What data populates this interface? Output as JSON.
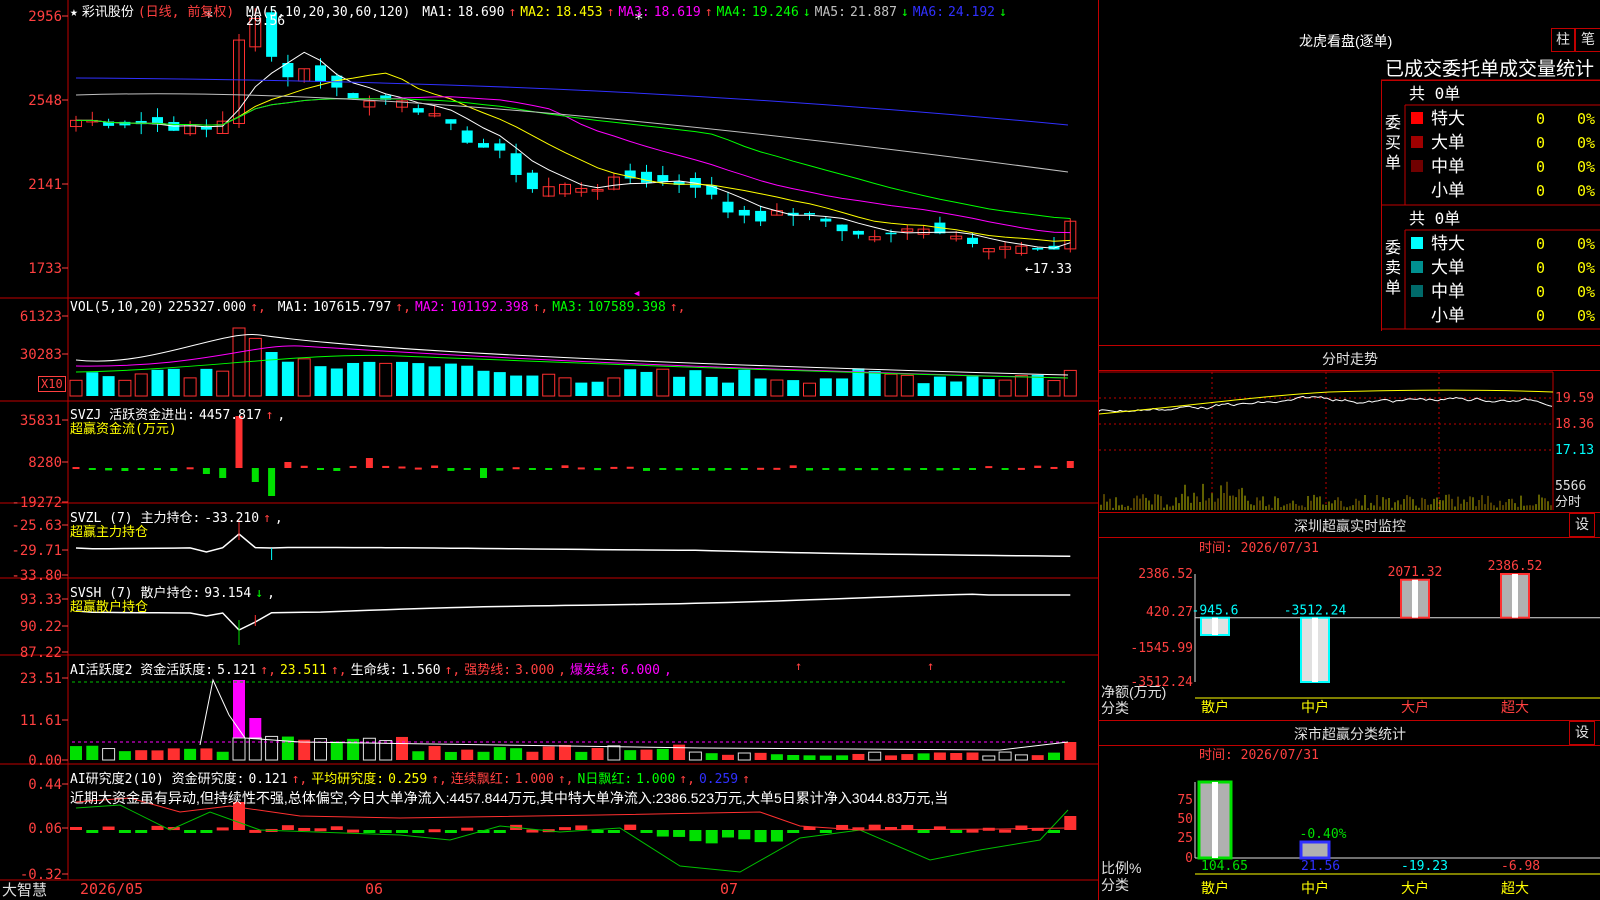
{
  "stock": {
    "name": "彩讯股份",
    "period": "(日线, 前复权)",
    "star": "★"
  },
  "main": {
    "ma_label": "MA(5,10,20,30,60,120)",
    "ma": [
      {
        "label": "MA1:",
        "value": "18.690",
        "dir": "↑",
        "color": "#ffffff"
      },
      {
        "label": "MA2:",
        "value": "18.453",
        "dir": "↑",
        "color": "#ffff00"
      },
      {
        "label": "MA3:",
        "value": "18.619",
        "dir": "↑",
        "color": "#ff00ff"
      },
      {
        "label": "MA4:",
        "value": "19.246",
        "dir": "↓",
        "color": "#00ff00"
      },
      {
        "label": "MA5:",
        "value": "21.887",
        "dir": "↓",
        "color": "#c0c0c0"
      },
      {
        "label": "MA6:",
        "value": "24.192",
        "dir": "↓",
        "color": "#3030ff"
      }
    ],
    "y_ticks": [
      "2956",
      "2548",
      "2141",
      "1733"
    ],
    "high_mark": "29.56",
    "low_mark": "←17.33"
  },
  "vol": {
    "label": "VOL(5,10,20)",
    "value": "225327.000",
    "ma": [
      {
        "label": "MA1:",
        "value": "107615.797",
        "dir": "↑",
        "color": "#ffffff"
      },
      {
        "label": "MA2:",
        "value": "101192.398",
        "dir": "↑",
        "color": "#ff00ff"
      },
      {
        "label": "MA3:",
        "value": "107589.398",
        "dir": "↑",
        "color": "#00ff00"
      }
    ],
    "y_ticks": [
      "61323",
      "30283"
    ],
    "unit": "X10"
  },
  "svzj": {
    "label": "SVZJ  活跃资金进出:",
    "value": "4457.817",
    "dir": "↑",
    "sub": "超赢资金流(万元)",
    "y_ticks": [
      "35831",
      "8280",
      "-19272"
    ]
  },
  "svzl": {
    "label": "SVZL  (7) 主力持仓:",
    "value": "-33.210",
    "dir": "↑",
    "sub": "超赢主力持仓",
    "y_ticks": [
      "-25.63",
      "-29.71",
      "-33.80"
    ]
  },
  "svsh": {
    "label": "SVSH  (7) 散户持仓:",
    "value": "93.154",
    "dir": "↓",
    "sub": "超赢散户持仓",
    "y_ticks": [
      "93.33",
      "90.22",
      "87.22"
    ]
  },
  "ai_active": {
    "label": "AI活跃度2 资金活跃度:",
    "value": "5.121",
    "dir": "↑",
    "v2": "23.511",
    "life_label": "生命线:",
    "life": "1.560",
    "strong_label": "强势线:",
    "strong": "3.000",
    "burst_label": "爆发线:",
    "burst": "6.000",
    "y_ticks": [
      "23.51",
      "11.61",
      "0.00"
    ]
  },
  "ai_research": {
    "label": "AI研究度2(10) 资金研究度:",
    "value": "0.121",
    "avg_label": "平均研究度:",
    "avg": "0.259",
    "cont_label": "连续飘红:",
    "cont": "1.000",
    "nday_label": "N日飘红:",
    "nday": "1.000",
    "extra": "0.259",
    "comment": "近期大资金虽有异动,但持续性不强,总体偏空,今日大单净流入:4457.844万元,其中特大单净流入:2386.523万元,大单5日累计净入3044.83万元,当",
    "y_ticks": [
      "0.44",
      "0.06",
      "-0.32"
    ]
  },
  "dates": {
    "brand": "大智慧",
    "d1": "2026/05",
    "d2": "06",
    "d3": "07"
  },
  "dragon": {
    "title": "龙虎看盘(逐单)",
    "btn1": "柱",
    "btn2": "笔",
    "subtitle": "已成交委托单成交量统计",
    "buy": {
      "side": "委买单",
      "total": "共 0单",
      "rows": [
        {
          "label": "特大",
          "count": "0",
          "pct": "0%",
          "color": "#ff0000"
        },
        {
          "label": "大单",
          "count": "0",
          "pct": "0%",
          "color": "#a00000"
        },
        {
          "label": "中单",
          "count": "0",
          "pct": "0%",
          "color": "#700000"
        },
        {
          "label": "小单",
          "count": "0",
          "pct": "0%",
          "color": ""
        }
      ]
    },
    "sell": {
      "side": "委卖单",
      "total": "共 0单",
      "rows": [
        {
          "label": "特大",
          "count": "0",
          "pct": "0%",
          "color": "#00ffff"
        },
        {
          "label": "大单",
          "count": "0",
          "pct": "0%",
          "color": "#009090"
        },
        {
          "label": "中单",
          "count": "0",
          "pct": "0%",
          "color": "#006a6a"
        },
        {
          "label": "小单",
          "count": "0",
          "pct": "0%",
          "color": ""
        }
      ]
    }
  },
  "intraday": {
    "title": "分时走势",
    "y_ticks": [
      "19.59",
      "18.36",
      "17.13"
    ],
    "vol_tick": "5566",
    "vol_unit": "分时"
  },
  "sz_monitor": {
    "title": "深圳超赢实时监控",
    "set": "设",
    "time": "时间: 2026/07/31",
    "y_ticks": [
      "2386.52",
      "420.27",
      "-1545.99",
      "-3512.24"
    ],
    "net_label": "净额(万元)",
    "class_label": "分类",
    "chart_data": {
      "type": "bar",
      "categories": [
        "散户",
        "中户",
        "大户",
        "超大"
      ],
      "values": [
        -945.6,
        -3512.24,
        2071.32,
        2386.52
      ],
      "value_labels": [
        "-945.6",
        "-3512.24",
        "2071.32",
        "2386.52"
      ],
      "ylim": [
        -3512.24,
        2386.52
      ]
    }
  },
  "sz_class": {
    "title": "深市超赢分类统计",
    "set": "设",
    "time": "时间: 2026/07/31",
    "y_ticks": [
      "75",
      "50",
      "25",
      "0"
    ],
    "ratio_label": "比例%",
    "class_label": "分类",
    "chart_data": {
      "type": "bar",
      "categories": [
        "散户",
        "中户",
        "大户",
        "超大"
      ],
      "values": [
        104.65,
        21.56,
        -19.23,
        -6.98
      ],
      "value_labels": [
        "104.65",
        "21.56",
        "-19.23",
        "-6.98"
      ],
      "bar_percent": [
        104.65,
        -0.4,
        0,
        0
      ],
      "bar_label": "-0.40%",
      "ylim": [
        0,
        100
      ]
    }
  }
}
